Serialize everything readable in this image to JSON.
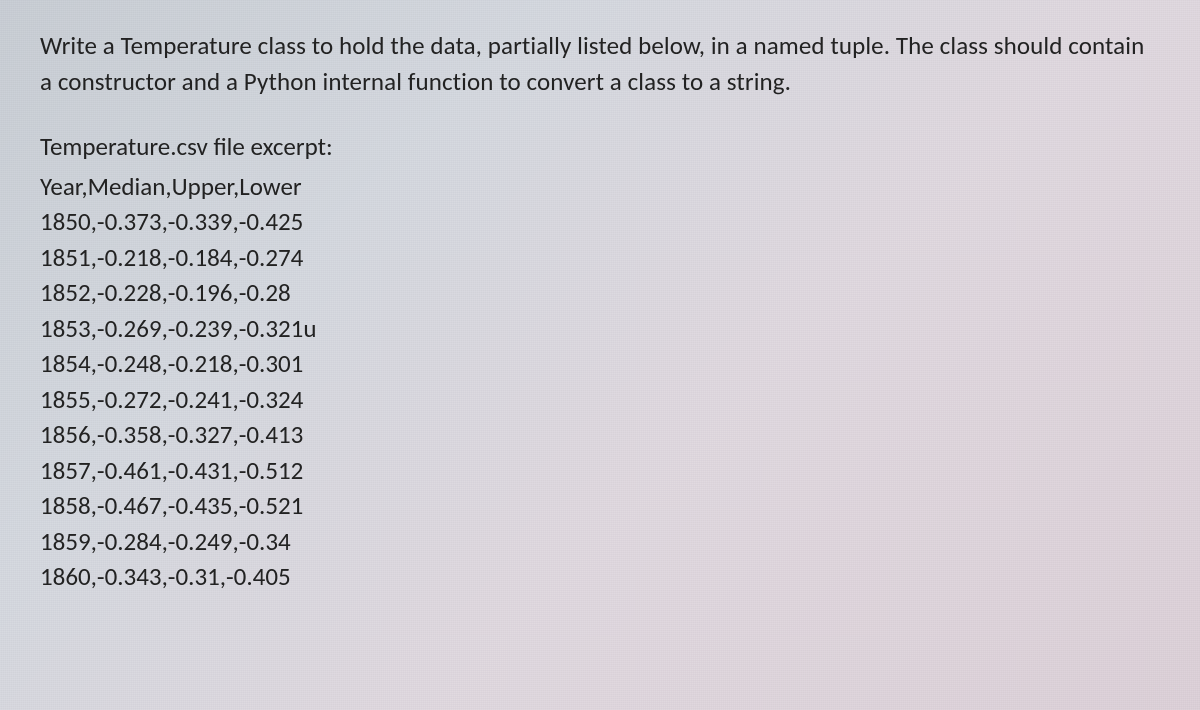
{
  "instructions": "Write a Temperature class to hold the data, partially listed below, in a named tuple. The class should contain a constructor and a Python internal function to convert a class to a string.",
  "excerpt_title": "Temperature.csv file excerpt:",
  "csv_header": "Year,Median,Upper,Lower",
  "csv_rows": [
    "1850,-0.373,-0.339,-0.425",
    "1851,-0.218,-0.184,-0.274",
    "1852,-0.228,-0.196,-0.28",
    "1853,-0.269,-0.239,-0.321u",
    "1854,-0.248,-0.218,-0.301",
    "1855,-0.272,-0.241,-0.324",
    "1856,-0.358,-0.327,-0.413",
    "1857,-0.461,-0.431,-0.512",
    "1858,-0.467,-0.435,-0.521",
    "1859,-0.284,-0.249,-0.34",
    "1860,-0.343,-0.31,-0.405"
  ]
}
